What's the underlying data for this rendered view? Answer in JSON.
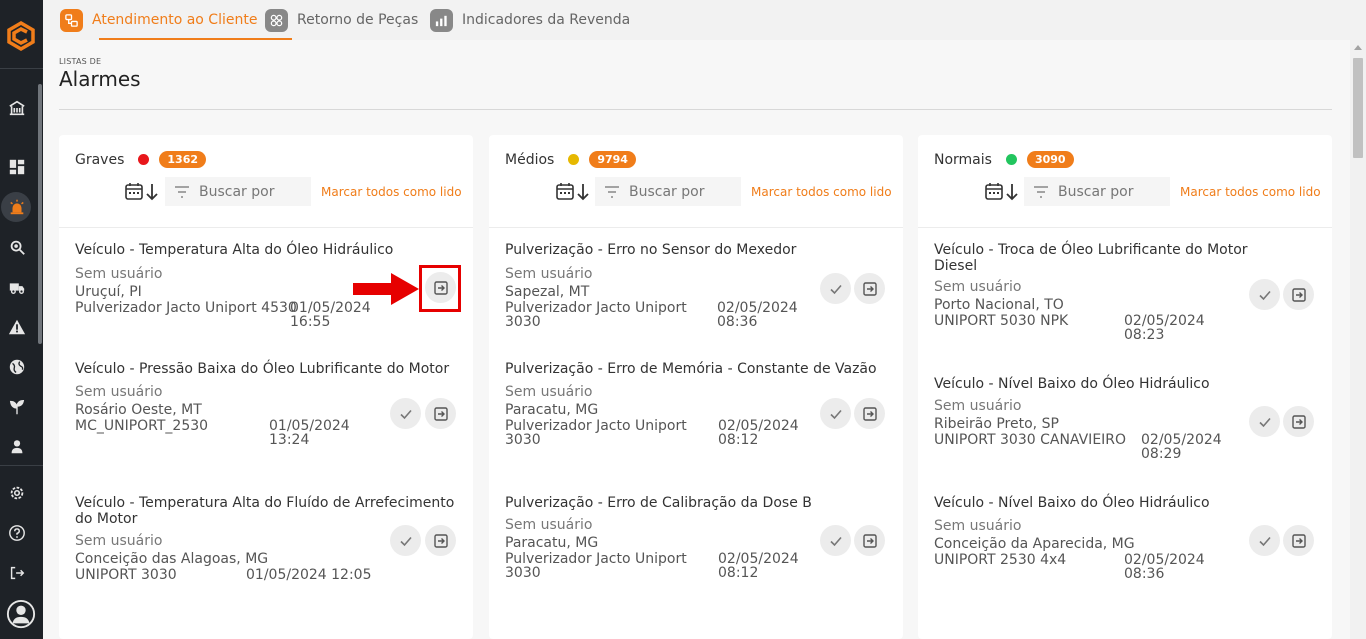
{
  "tabs": [
    {
      "label": "Atendimento ao Cliente",
      "active": true,
      "icon": "support-icon"
    },
    {
      "label": "Retorno de Peças",
      "active": false,
      "icon": "parts-icon"
    },
    {
      "label": "Indicadores da Revenda",
      "active": false,
      "icon": "chart-icon"
    }
  ],
  "page": {
    "eyebrow": "LISTAS DE",
    "title": "Alarmes"
  },
  "columns": [
    {
      "name": "Graves",
      "count": "1362",
      "dot_color": "#e8171b",
      "search_placeholder": "Buscar por",
      "mark_read": "Marcar todos como lido",
      "items": [
        {
          "title": "Veículo - Temperatura Alta do Óleo Hidráulico",
          "user": "Sem usuário",
          "location": "Uruçuí, PI",
          "model": "Pulverizador Jacto Uniport 4530",
          "date": "01/05/2024",
          "time": "16:55"
        },
        {
          "title": "Veículo - Pressão Baixa do Óleo Lubrificante do Motor",
          "user": "Sem usuário",
          "location": "Rosário Oeste, MT",
          "model": "MC_UNIPORT_2530",
          "date": "01/05/2024",
          "time": "13:24"
        },
        {
          "title": "Veículo - Temperatura Alta do Fluído de Arrefecimento do Motor",
          "user": "Sem usuário",
          "location": "Conceição das Alagoas, MG",
          "model": "UNIPORT 3030",
          "date": "01/05/2024 12:05",
          "time": ""
        }
      ]
    },
    {
      "name": "Médios",
      "count": "9794",
      "dot_color": "#e6b800",
      "search_placeholder": "Buscar por",
      "mark_read": "Marcar todos como lido",
      "items": [
        {
          "title": "Pulverização - Erro no Sensor do Mexedor",
          "user": "Sem usuário",
          "location": "Sapezal, MT",
          "model": "Pulverizador Jacto Uniport",
          "model2": "3030",
          "date": "02/05/2024",
          "time": "08:36"
        },
        {
          "title": "Pulverização - Erro de Memória - Constante de Vazão",
          "user": "Sem usuário",
          "location": "Paracatu, MG",
          "model": "Pulverizador Jacto Uniport",
          "model2": "3030",
          "date": "02/05/2024",
          "time": "08:12"
        },
        {
          "title": "Pulverização - Erro de Calibração da Dose B",
          "user": "Sem usuário",
          "location": "Paracatu, MG",
          "model": "Pulverizador Jacto Uniport",
          "model2": "3030",
          "date": "02/05/2024",
          "time": "08:12"
        }
      ]
    },
    {
      "name": "Normais",
      "count": "3090",
      "dot_color": "#22c55e",
      "search_placeholder": "Buscar por",
      "mark_read": "Marcar todos como lido",
      "items": [
        {
          "title": "Veículo - Troca de Óleo Lubrificante do Motor Diesel",
          "user": "Sem usuário",
          "location": "Porto Nacional, TO",
          "model": "UNIPORT 5030 NPK",
          "date": "02/05/2024",
          "time": "08:23"
        },
        {
          "title": "Veículo - Nível Baixo do Óleo Hidráulico",
          "user": "Sem usuário",
          "location": "Ribeirão Preto, SP",
          "model": "UNIPORT 3030 CANAVIEIRO",
          "date": "02/05/2024",
          "time": "08:29"
        },
        {
          "title": "Veículo - Nível Baixo do Óleo Hidráulico",
          "user": "Sem usuário",
          "location": "Conceição da Aparecida, MG",
          "model": "UNIPORT 2530 4x4",
          "date": "02/05/2024",
          "time": "08:36"
        }
      ]
    }
  ],
  "colors": {
    "accent": "#f07d1a",
    "sidebar": "#1e2227",
    "annotation": "#e60000"
  }
}
